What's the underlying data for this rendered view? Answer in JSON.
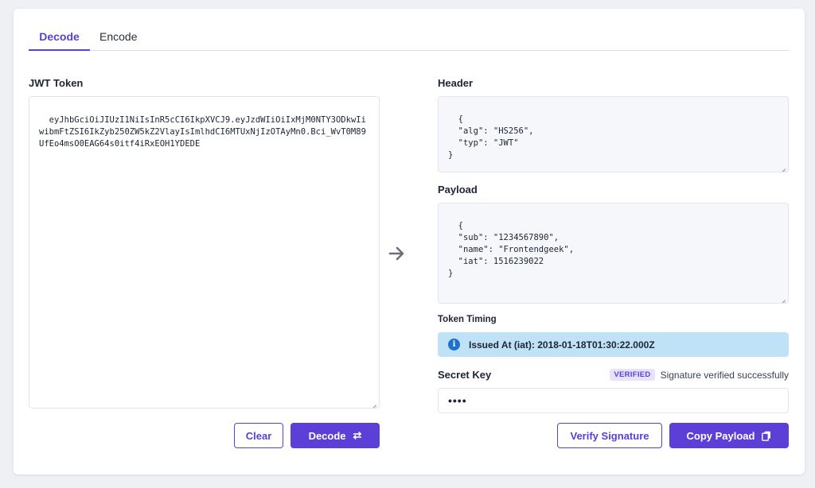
{
  "tabs": [
    {
      "label": "Decode",
      "active": true
    },
    {
      "label": "Encode",
      "active": false
    }
  ],
  "token": {
    "label": "JWT Token",
    "value": "eyJhbGciOiJIUzI1NiIsInR5cCI6IkpXVCJ9.eyJzdWIiOiIxMjM0NTY3ODkwIiwibmFtZSI6IkZyb250ZW5kZ2VlayIsImlhdCI6MTUxNjIzOTAyMn0.Bci_WvT0M89UfEo4msO0EAG64s0itf4iRxEOH1YDEDE"
  },
  "header": {
    "label": "Header",
    "value": "{\n  \"alg\": \"HS256\",\n  \"typ\": \"JWT\"\n}"
  },
  "payload": {
    "label": "Payload",
    "value": "{\n  \"sub\": \"1234567890\",\n  \"name\": \"Frontendgeek\",\n  \"iat\": 1516239022\n}"
  },
  "timing": {
    "label": "Token Timing",
    "issued": "Issued At (iat): 2018-01-18T01:30:22.000Z",
    "icon": "info-icon"
  },
  "secret": {
    "label": "Secret Key",
    "value": "••••",
    "badge": "VERIFIED",
    "status": "Signature verified successfully"
  },
  "buttons": {
    "clear": "Clear",
    "decode": "Decode",
    "decode_icon": "⇄",
    "verify": "Verify Signature",
    "copy": "Copy Payload",
    "copy_icon": "copy-icon"
  },
  "colors": {
    "accent": "#5b3fd6",
    "info_bg": "#bfe2f6",
    "info_icon": "#1d6fd0"
  }
}
